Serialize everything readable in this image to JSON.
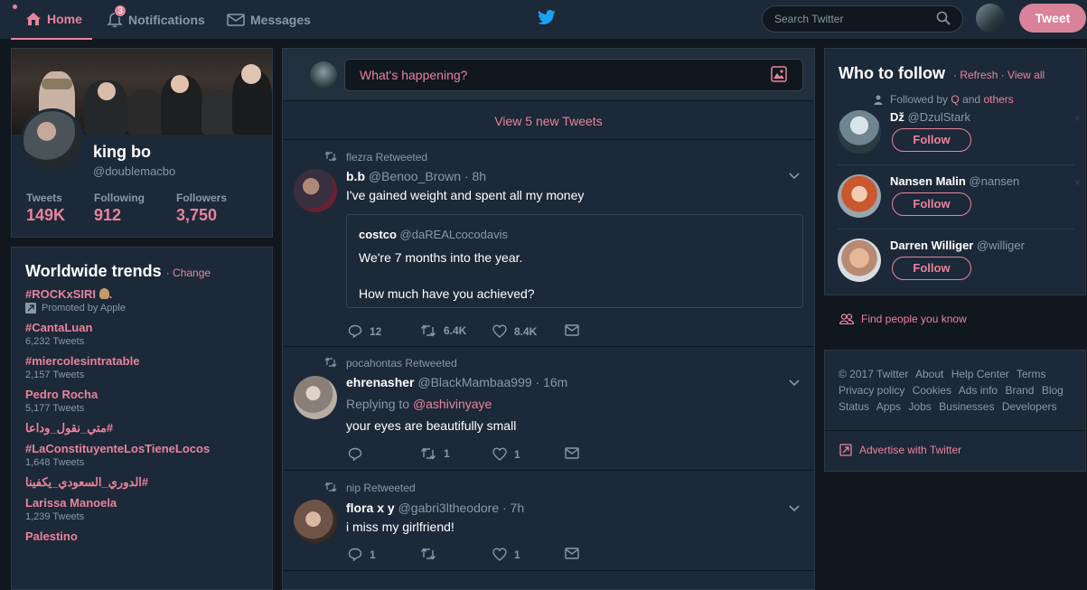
{
  "topbar": {
    "home_label": "Home",
    "notifications_label": "Notifications",
    "notifications_count": "3",
    "messages_label": "Messages",
    "search_placeholder": "Search Twitter",
    "tweet_button": "Tweet"
  },
  "profile": {
    "name": "king bo",
    "handle": "@doublemacbo",
    "stats": [
      {
        "label": "Tweets",
        "value": "149K"
      },
      {
        "label": "Following",
        "value": "912"
      },
      {
        "label": "Followers",
        "value": "3,750"
      }
    ]
  },
  "trends": {
    "title": "Worldwide trends",
    "change_label": "Change",
    "items": [
      {
        "name": "#ROCKxSIRI",
        "meta": "Promoted by Apple",
        "promoted": true
      },
      {
        "name": "#CantaLuan",
        "meta": "6,232 Tweets"
      },
      {
        "name": "#miercolesintratable",
        "meta": "2,157 Tweets"
      },
      {
        "name": "Pedro Rocha",
        "meta": "5,177 Tweets"
      },
      {
        "name": "#متي_نقول_وداعا",
        "meta": ""
      },
      {
        "name": "#LaConstituyenteLosTieneLocos",
        "meta": "1,648 Tweets"
      },
      {
        "name": "#الدوري_السعودي_يكفينا",
        "meta": ""
      },
      {
        "name": "Larissa Manoela",
        "meta": "1,239 Tweets"
      },
      {
        "name": "Palestino",
        "meta": ""
      }
    ]
  },
  "compose": {
    "placeholder": "What's happening?",
    "new_tweets_label": "View 5 new Tweets"
  },
  "tweets": [
    {
      "retweeted_by": "flezra Retweeted",
      "name": "b.b",
      "handle": "@Benoo_Brown",
      "time": "· 8h",
      "text": "I've gained weight and spent all my money",
      "quote": {
        "name": "costco",
        "handle": "@daREALcocodavis",
        "line1": "We're 7 months into the year.",
        "line2": "How much have you achieved?"
      },
      "replies": "12",
      "retweets": "6.4K",
      "likes": "8.4K"
    },
    {
      "retweeted_by": "pocahontas Retweeted",
      "name": "ehrenasher",
      "handle": "@BlackMambaa999",
      "time": "· 16m",
      "replying_to_label": "Replying to",
      "replying_to": "@ashivinyaye",
      "text": "your eyes are beautifully small",
      "replies": "",
      "retweets": "1",
      "likes": "1"
    },
    {
      "retweeted_by": "nip Retweeted",
      "name": "flora x y",
      "handle": "@gabri3ltheodore",
      "time": "· 7h",
      "text": "i miss my girlfriend!",
      "replies": "1",
      "retweets": "",
      "likes": "1"
    }
  ],
  "who_to_follow": {
    "title": "Who to follow",
    "refresh": "Refresh",
    "view_all": "View all",
    "followed_by_prefix": "Followed by",
    "followed_by_user": "Q",
    "followed_by_and": "and",
    "followed_by_others": "others",
    "follow_label": "Follow",
    "close_glyph": "×",
    "users": [
      {
        "name": "Dž",
        "handle": "@DzulStark"
      },
      {
        "name": "Nansen Malin",
        "handle": "@nansen"
      },
      {
        "name": "Darren Williger",
        "handle": "@williger"
      }
    ],
    "find_people": "Find people you know"
  },
  "footer": {
    "links": [
      "© 2017 Twitter",
      "About",
      "Help Center",
      "Terms",
      "Privacy policy",
      "Cookies",
      "Ads info",
      "Brand",
      "Blog",
      "Status",
      "Apps",
      "Jobs",
      "Businesses",
      "Developers"
    ],
    "advertise": "Advertise with Twitter"
  },
  "colors": {
    "accent": "#e9839d",
    "background": "#10171e",
    "card": "#1c2938",
    "muted": "#8899a6"
  }
}
